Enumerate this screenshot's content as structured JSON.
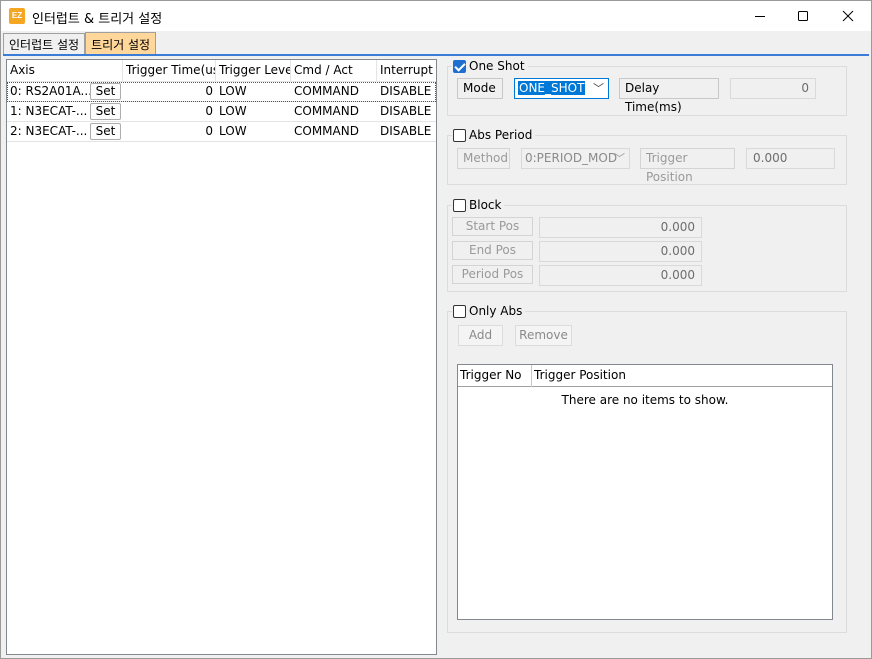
{
  "window": {
    "title": "인터럽트 & 트리거 설정",
    "app_icon_text": "EZ",
    "controls": {
      "minimize": "—",
      "maximize": "☐",
      "close": "✕"
    }
  },
  "tabs": [
    {
      "label": "인터럽트 설정",
      "active": false
    },
    {
      "label": "트리거 설정",
      "active": true
    }
  ],
  "axis_list": {
    "columns": [
      "Axis",
      "Trigger Time(us)",
      "Trigger Level",
      "Cmd / Act",
      "Interrupt"
    ],
    "rows": [
      {
        "axis": "0: RS2A01A...",
        "set": "Set",
        "trigger_time": "0",
        "trigger_level": "LOW",
        "cmd_act": "COMMAND",
        "interrupt": "DISABLE"
      },
      {
        "axis": "1: N3ECAT-...",
        "set": "Set",
        "trigger_time": "0",
        "trigger_level": "LOW",
        "cmd_act": "COMMAND",
        "interrupt": "DISABLE"
      },
      {
        "axis": "2: N3ECAT-...",
        "set": "Set",
        "trigger_time": "0",
        "trigger_level": "LOW",
        "cmd_act": "COMMAND",
        "interrupt": "DISABLE"
      }
    ]
  },
  "one_shot": {
    "label": "One Shot",
    "checked": true,
    "mode_label": "Mode",
    "mode_value": "ONE_SHOT",
    "delay_label": "Delay Time(ms)",
    "delay_value": "0"
  },
  "abs_period": {
    "label": "Abs Period",
    "checked": false,
    "method_label": "Method",
    "method_value": "0:PERIOD_MOD",
    "trigger_position_label": "Trigger Position",
    "trigger_position_value": "0.000"
  },
  "block": {
    "label": "Block",
    "checked": false,
    "start_pos_label": "Start Pos",
    "start_pos_value": "0.000",
    "end_pos_label": "End Pos",
    "end_pos_value": "0.000",
    "period_pos_label": "Period Pos",
    "period_pos_value": "0.000"
  },
  "only_abs": {
    "label": "Only Abs",
    "checked": false,
    "add_label": "Add",
    "remove_label": "Remove",
    "columns": [
      "Trigger No",
      "Trigger Position"
    ],
    "empty_text": "There are no items to show."
  },
  "colors": {
    "active_tab": "#ffd79b",
    "tab_accent": "#3b7cd8",
    "checkbox_checked": "#1f6fd0",
    "selection": "#0078d7"
  }
}
